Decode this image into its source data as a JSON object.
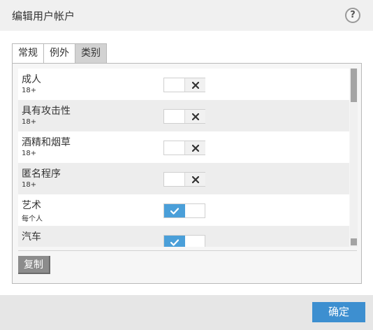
{
  "dialog": {
    "title": "编辑用户帐户",
    "help_label": "?"
  },
  "tabs": [
    {
      "label": "常规"
    },
    {
      "label": "例外"
    },
    {
      "label": "类别"
    }
  ],
  "categories": [
    {
      "name": "成人",
      "age": "18+",
      "enabled": false
    },
    {
      "name": "具有攻击性",
      "age": "18+",
      "enabled": false
    },
    {
      "name": "酒精和烟草",
      "age": "18+",
      "enabled": false
    },
    {
      "name": "匿名程序",
      "age": "18+",
      "enabled": false
    },
    {
      "name": "艺术",
      "age": "每个人",
      "enabled": true
    },
    {
      "name": "汽车",
      "age": "",
      "enabled": true
    }
  ],
  "buttons": {
    "copy": "复制",
    "ok": "确定"
  },
  "colors": {
    "accent": "#3d8fd0",
    "toggle_on": "#4a9fd9",
    "copy_button": "#8c8c8c"
  },
  "icons": {
    "off": "close-icon",
    "on": "check-icon"
  }
}
